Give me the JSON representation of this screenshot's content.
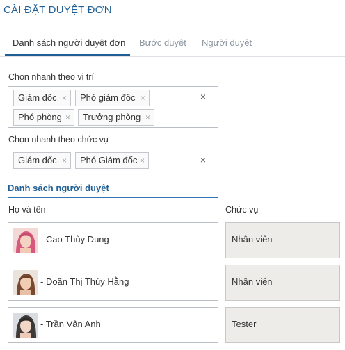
{
  "header": {
    "title": "CÀI ĐẶT DUYỆT ĐƠN"
  },
  "tabs": [
    {
      "label": "Danh sách người duyệt đơn",
      "active": true
    },
    {
      "label": "Bước duyệt",
      "active": false
    },
    {
      "label": "Người duyệt",
      "active": false
    }
  ],
  "quick_position": {
    "label": "Chọn nhanh theo vị trí",
    "tags": [
      "Giám đốc",
      "Phó giám đốc",
      "Phó phòng",
      "Trưởng phòng"
    ]
  },
  "quick_role": {
    "label": "Chọn nhanh theo chức vụ",
    "tags": [
      "Giám đốc",
      "Phó Giám đốc"
    ]
  },
  "approvers": {
    "title": "Danh sách người duyệt",
    "col_name": "Họ và tên",
    "col_role": "Chức vụ",
    "rows": [
      {
        "name": "- Cao Thùy Dung",
        "role": "Nhân viên"
      },
      {
        "name": "- Doãn Thị Thúy Hằng",
        "role": "Nhân viên"
      },
      {
        "name": "- Trần Vân Anh",
        "role": "Tester"
      }
    ]
  },
  "icons": {
    "remove": "×",
    "clear": "×"
  },
  "colors": {
    "accent": "#1f5f95",
    "readonly_bg": "#eeece9"
  }
}
